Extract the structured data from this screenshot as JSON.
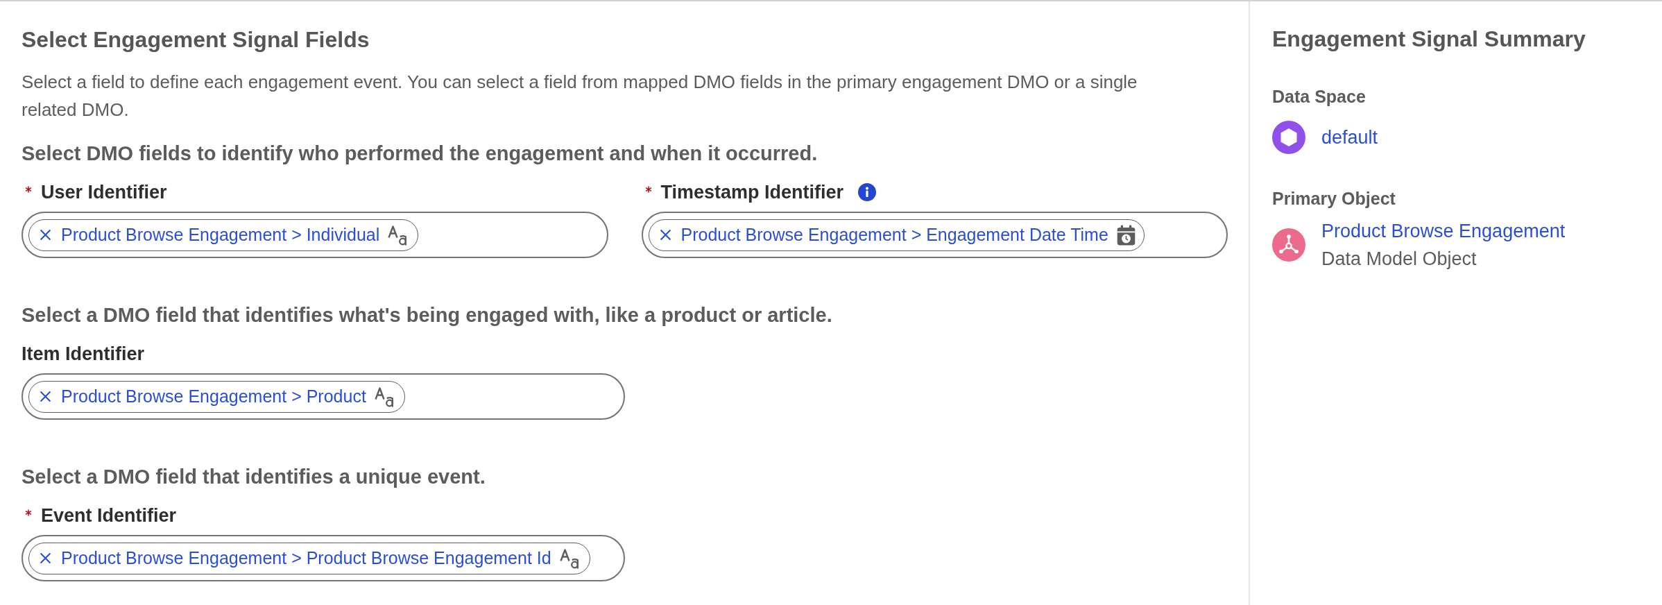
{
  "main": {
    "title": "Select Engagement Signal Fields",
    "description": "Select a field to define each engagement event. You can select a field from mapped DMO fields in the primary engagement DMO or a single related DMO.",
    "sections": [
      {
        "heading": "Select DMO fields to identify who performed the engagement and when it occurred.",
        "fields": [
          {
            "label": "User Identifier",
            "required": true,
            "info": false,
            "value": {
              "text": "Product Browse Engagement > Individual",
              "kind": "text"
            }
          },
          {
            "label": "Timestamp Identifier",
            "required": true,
            "info": true,
            "value": {
              "text": "Product Browse Engagement > Engagement Date Time",
              "kind": "datetime"
            }
          }
        ]
      },
      {
        "heading": "Select a DMO field that identifies what's being engaged with, like a product or article.",
        "fields": [
          {
            "label": "Item Identifier",
            "required": false,
            "info": false,
            "value": {
              "text": "Product Browse Engagement > Product",
              "kind": "text"
            }
          }
        ]
      },
      {
        "heading": "Select a DMO field that identifies a unique event.",
        "fields": [
          {
            "label": "Event Identifier",
            "required": true,
            "info": false,
            "value": {
              "text": "Product Browse Engagement > Product Browse Engagement Id",
              "kind": "text"
            }
          }
        ]
      }
    ]
  },
  "summary": {
    "title": "Engagement Signal Summary",
    "items": [
      {
        "kind": "data-space",
        "label": "Data Space",
        "link": "default"
      },
      {
        "kind": "object",
        "label": "Primary Object",
        "link": "Product Browse Engagement",
        "subtext": "Data Model Object"
      }
    ]
  }
}
